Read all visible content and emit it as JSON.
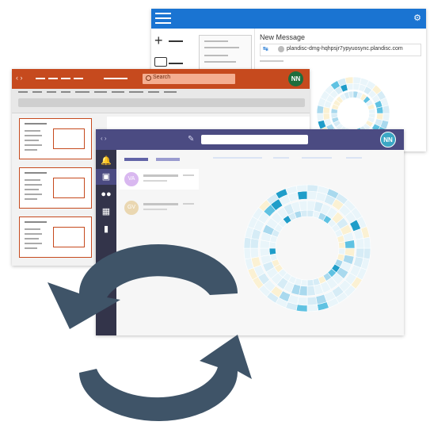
{
  "mail": {
    "compose_title": "New Message",
    "recipient": "plandisc-dmg-hqhpsjr7ypyuosync.plandisc.com",
    "colors": {
      "topbar": "#1a74d2"
    }
  },
  "powerpoint": {
    "search_placeholder": "Search",
    "avatar_initials": "NN",
    "colors": {
      "titlebar": "#c64a1e",
      "accent": "#c64a1e",
      "avatar": "#1e6e3d"
    }
  },
  "teams": {
    "avatar_initials": "NN",
    "chats": [
      {
        "initials": "VA",
        "avatar_color": "#d9b8f0"
      },
      {
        "initials": "GV",
        "avatar_color": "#ead7b1"
      }
    ],
    "rail_icons": [
      "bell-icon",
      "chat-icon",
      "teams-icon",
      "calendar-icon",
      "file-icon"
    ],
    "colors": {
      "titlebar": "#4b4b82",
      "rail": "#33344a",
      "avatar": "#3ba7c4"
    }
  },
  "arrows": {
    "color": "#3f5468",
    "icon": "sync-arrows-icon"
  }
}
